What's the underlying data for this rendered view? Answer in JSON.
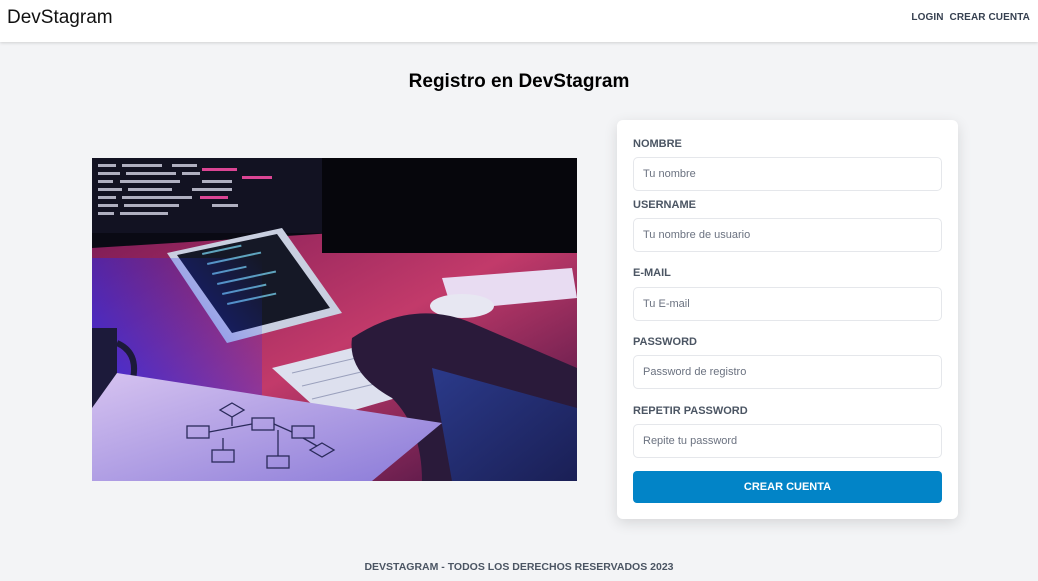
{
  "header": {
    "brand": "DevStagram",
    "nav": {
      "login": "Login",
      "register": "Crear Cuenta"
    }
  },
  "page": {
    "title": "Registro en DevStagram"
  },
  "hero_image": {
    "description_icon": "laptop-coding-photo"
  },
  "form": {
    "name": {
      "label": "Nombre",
      "placeholder": "Tu nombre",
      "value": ""
    },
    "username": {
      "label": "Username",
      "placeholder": "Tu nombre de usuario",
      "value": ""
    },
    "email": {
      "label": "E-mail",
      "placeholder": "Tu E-mail",
      "value": ""
    },
    "password": {
      "label": "Password",
      "placeholder": "Password de registro",
      "value": ""
    },
    "password_confirm": {
      "label": "Repetir Password",
      "placeholder": "Repite tu password",
      "value": ""
    },
    "submit_label": "Crear Cuenta"
  },
  "footer": {
    "text": "DevStagram - Todos los derechos reservados 2023"
  },
  "colors": {
    "accent": "#0284c7",
    "background": "#f3f4f6",
    "card": "#ffffff"
  }
}
